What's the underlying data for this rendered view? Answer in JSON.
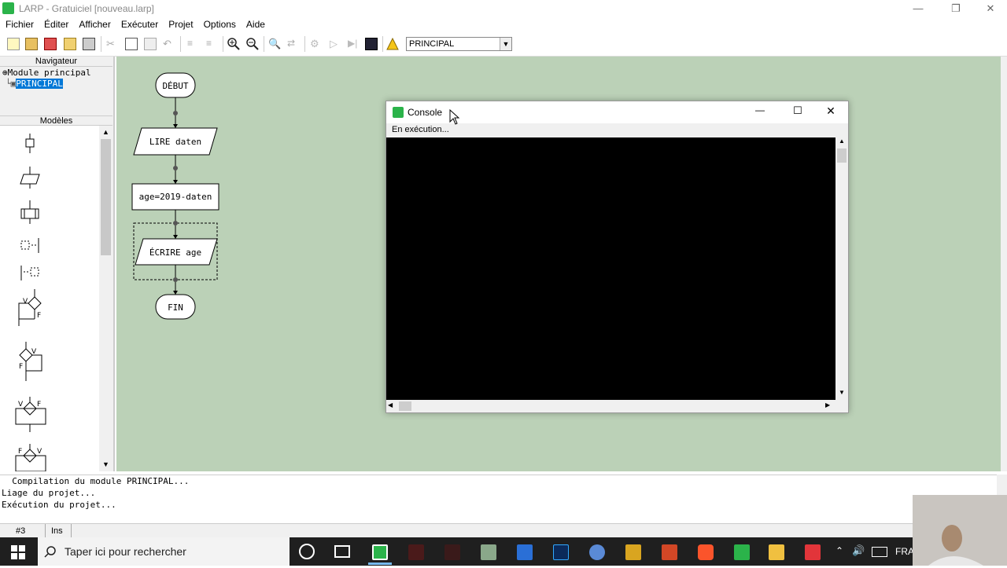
{
  "window": {
    "title": "LARP - Gratuiciel [nouveau.larp]"
  },
  "menu": [
    "Fichier",
    "Éditer",
    "Afficher",
    "Exécuter",
    "Projet",
    "Options",
    "Aide"
  ],
  "toolbar": {
    "module_select": "PRINCIPAL"
  },
  "navigator": {
    "header": "Navigateur",
    "root": "Module principal",
    "child": "PRINCIPAL"
  },
  "templates": {
    "header": "Modèles"
  },
  "flowchart": {
    "start": "DÉBUT",
    "read": "LIRE daten",
    "assign": "age=2019-daten",
    "write": "ÉCRIRE age",
    "end": "FIN"
  },
  "console": {
    "title": "Console",
    "status": "En exécution..."
  },
  "output": {
    "lines": [
      "  Compilation du module PRINCIPAL...",
      "Liage du projet...",
      "Exécution du projet..."
    ]
  },
  "status": {
    "line": "#3",
    "mode": "Ins"
  },
  "taskbar": {
    "search_placeholder": "Taper ici pour rechercher",
    "lang": "FRA"
  },
  "colors": {
    "canvas": "#bbd1b7",
    "accent": "#0078d7"
  }
}
